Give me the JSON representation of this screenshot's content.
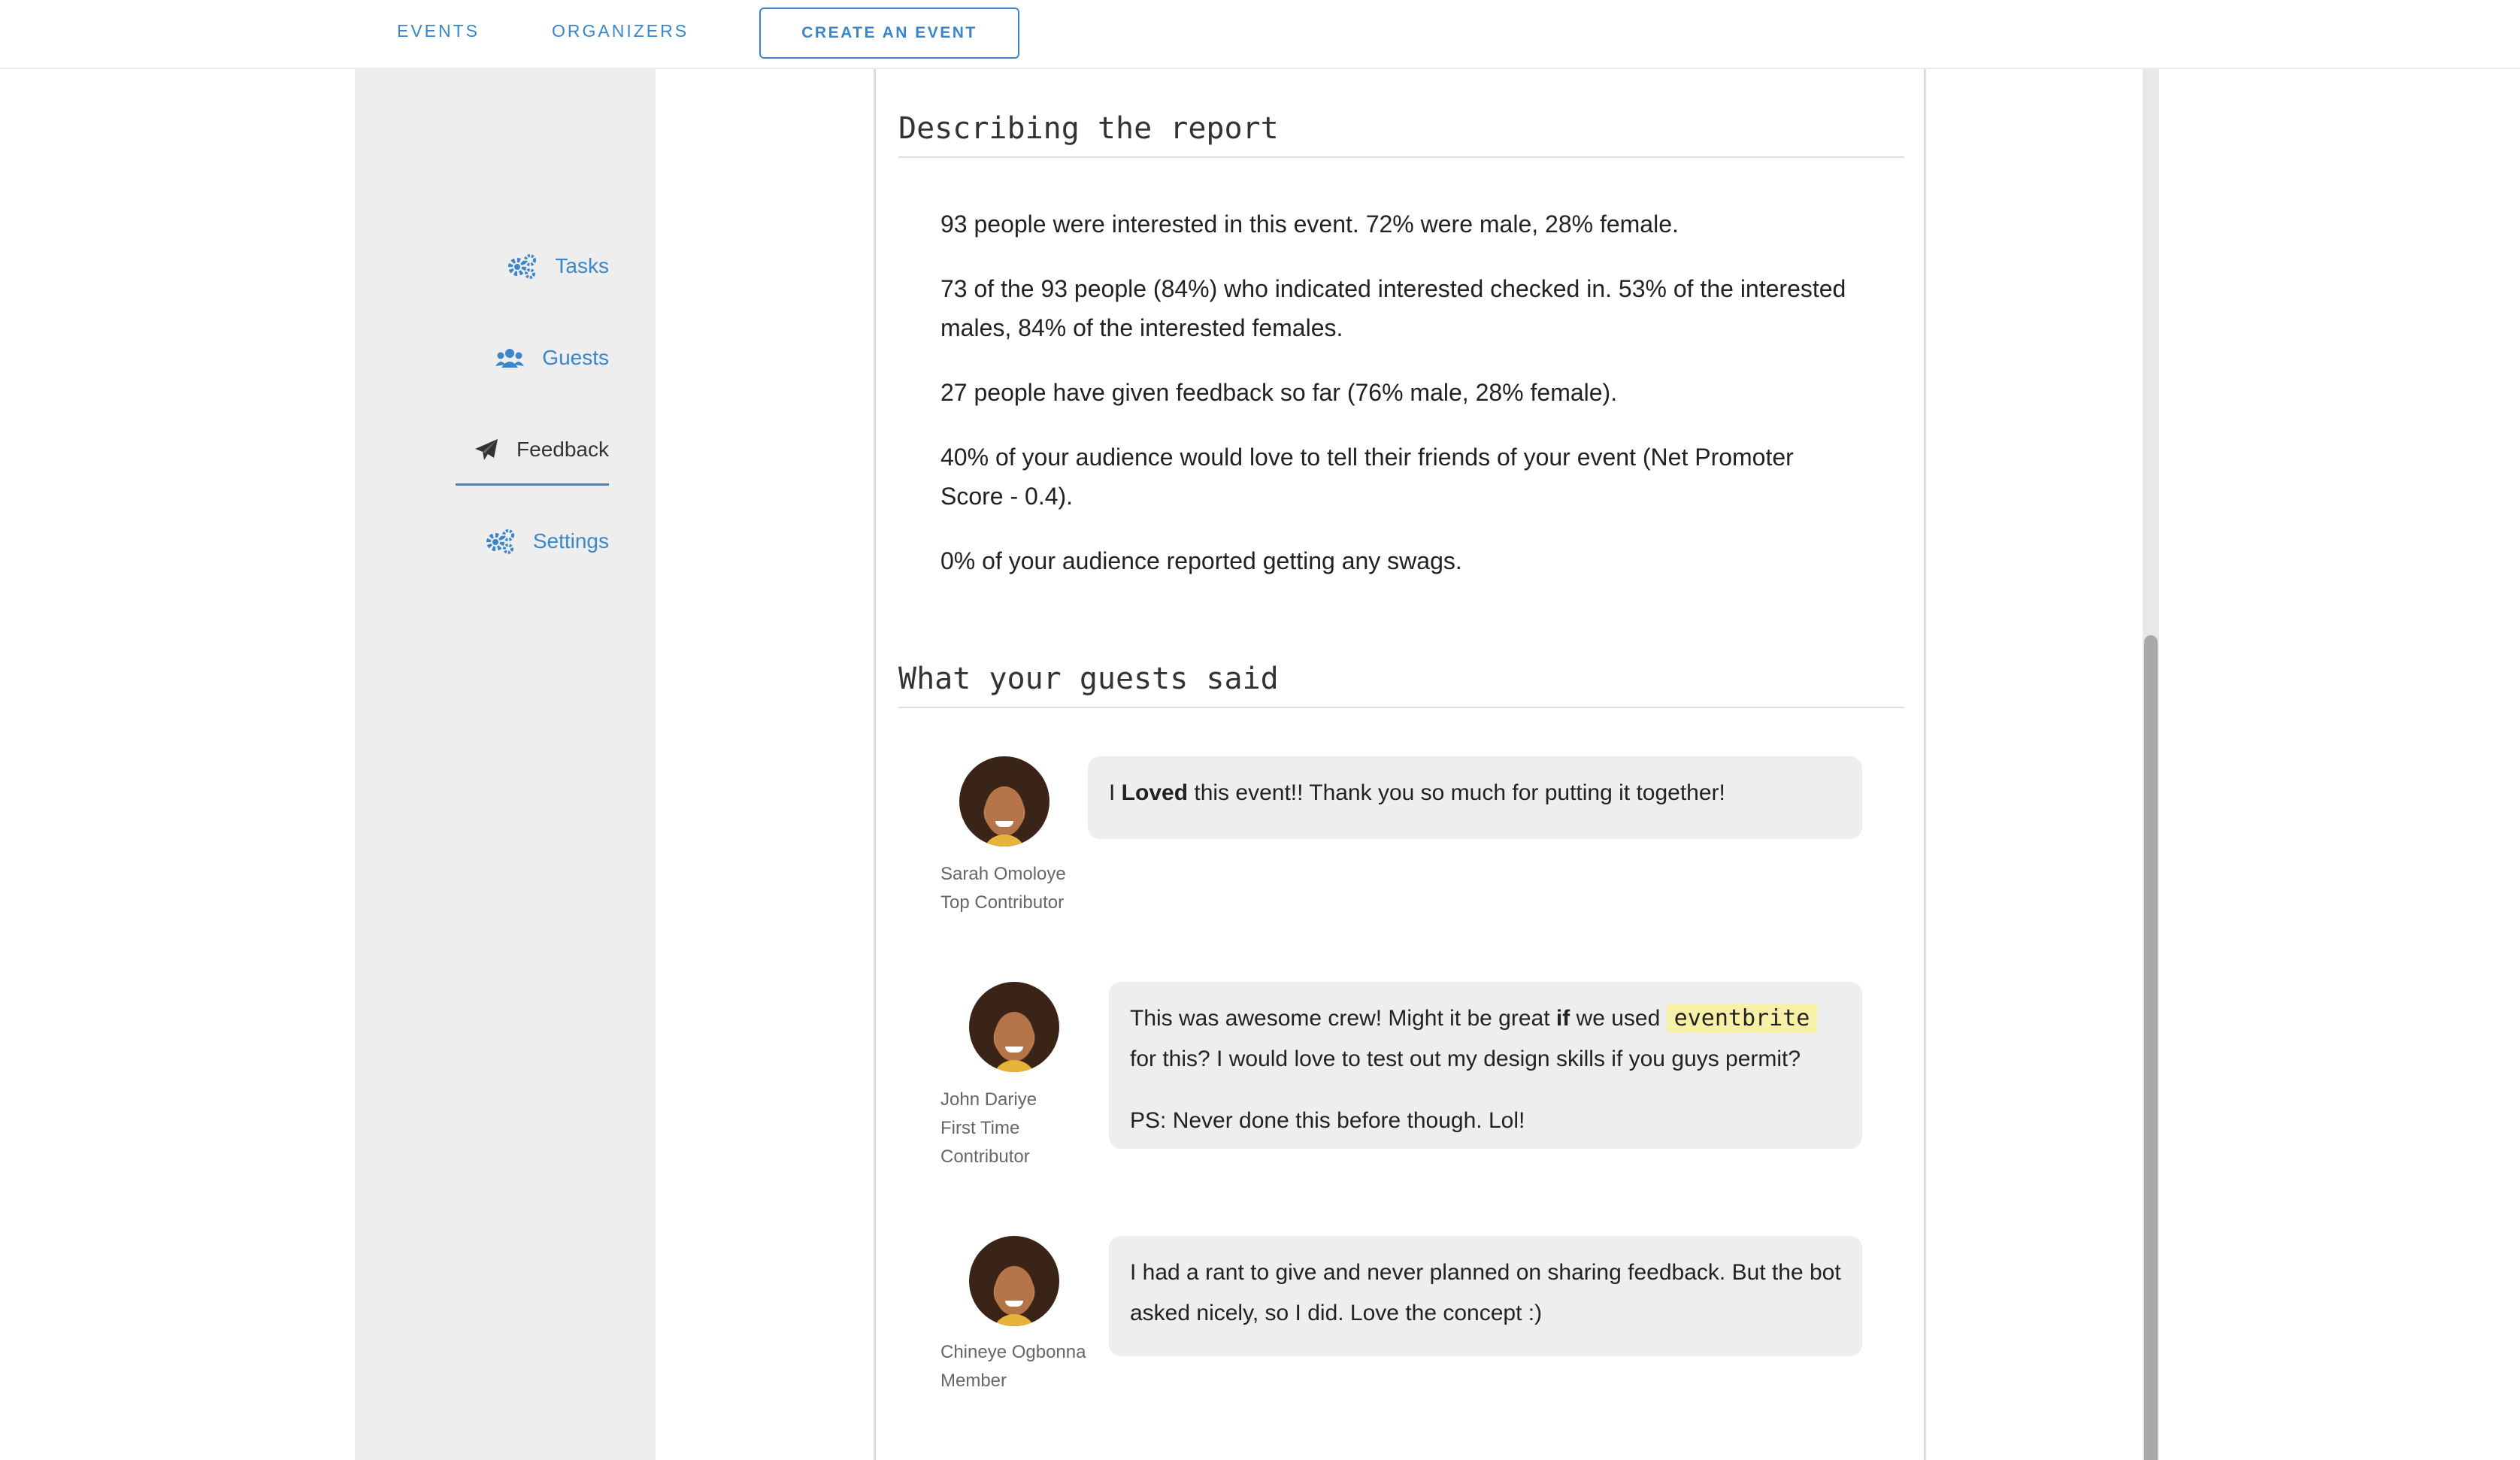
{
  "nav": {
    "events": "EVENTS",
    "organizers": "ORGANIZERS",
    "create": "CREATE AN EVENT"
  },
  "sidebar": {
    "items": [
      {
        "label": "Tasks",
        "icon": "gears-icon"
      },
      {
        "label": "Guests",
        "icon": "users-icon"
      },
      {
        "label": "Feedback",
        "icon": "paper-plane-icon",
        "active": true
      },
      {
        "label": "Settings",
        "icon": "gears-icon"
      }
    ]
  },
  "report": {
    "title": "Describing the report",
    "lines": [
      "93 people were interested in this event. 72% were male, 28% female.",
      "73 of the 93 people (84%) who indicated interested checked in. 53% of the interested males, 84% of the interested females.",
      "27 people have given feedback so far (76% male, 28% female).",
      "40% of your audience would love to tell their friends of your event (Net Promoter Score - 0.4).",
      "0% of your audience reported getting any swags."
    ]
  },
  "feedback": {
    "title": "What your guests said",
    "items": [
      {
        "name": "Sarah Omoloye",
        "role": "Top Contributor",
        "pre": "I ",
        "bold": "Loved",
        "post": " this event!! Thank you so much for putting it together!"
      },
      {
        "name": "John Dariye",
        "role_line1": "First Time",
        "role_line2": "Contributor",
        "p1_pre": "This was awesome crew! Might it be great ",
        "p1_bold": "if",
        "p1_mid": " we used ",
        "p1_code": "eventbrite",
        "p1_post": "for this?  I would love to test out my design skills if you guys permit?",
        "p2": "PS: Never done this before though. Lol!"
      },
      {
        "name": "Chineye Ogbonna",
        "role": "Member",
        "text": "I had a rant to give and never planned on sharing feedback. But the bot asked nicely, so I did. Love the concept :)"
      }
    ]
  },
  "colors": {
    "accent": "#3a86c8",
    "sidebar_bg": "#eeeeee",
    "bubble_bg": "#eeeeee",
    "code_highlight": "#f7f1a8"
  }
}
